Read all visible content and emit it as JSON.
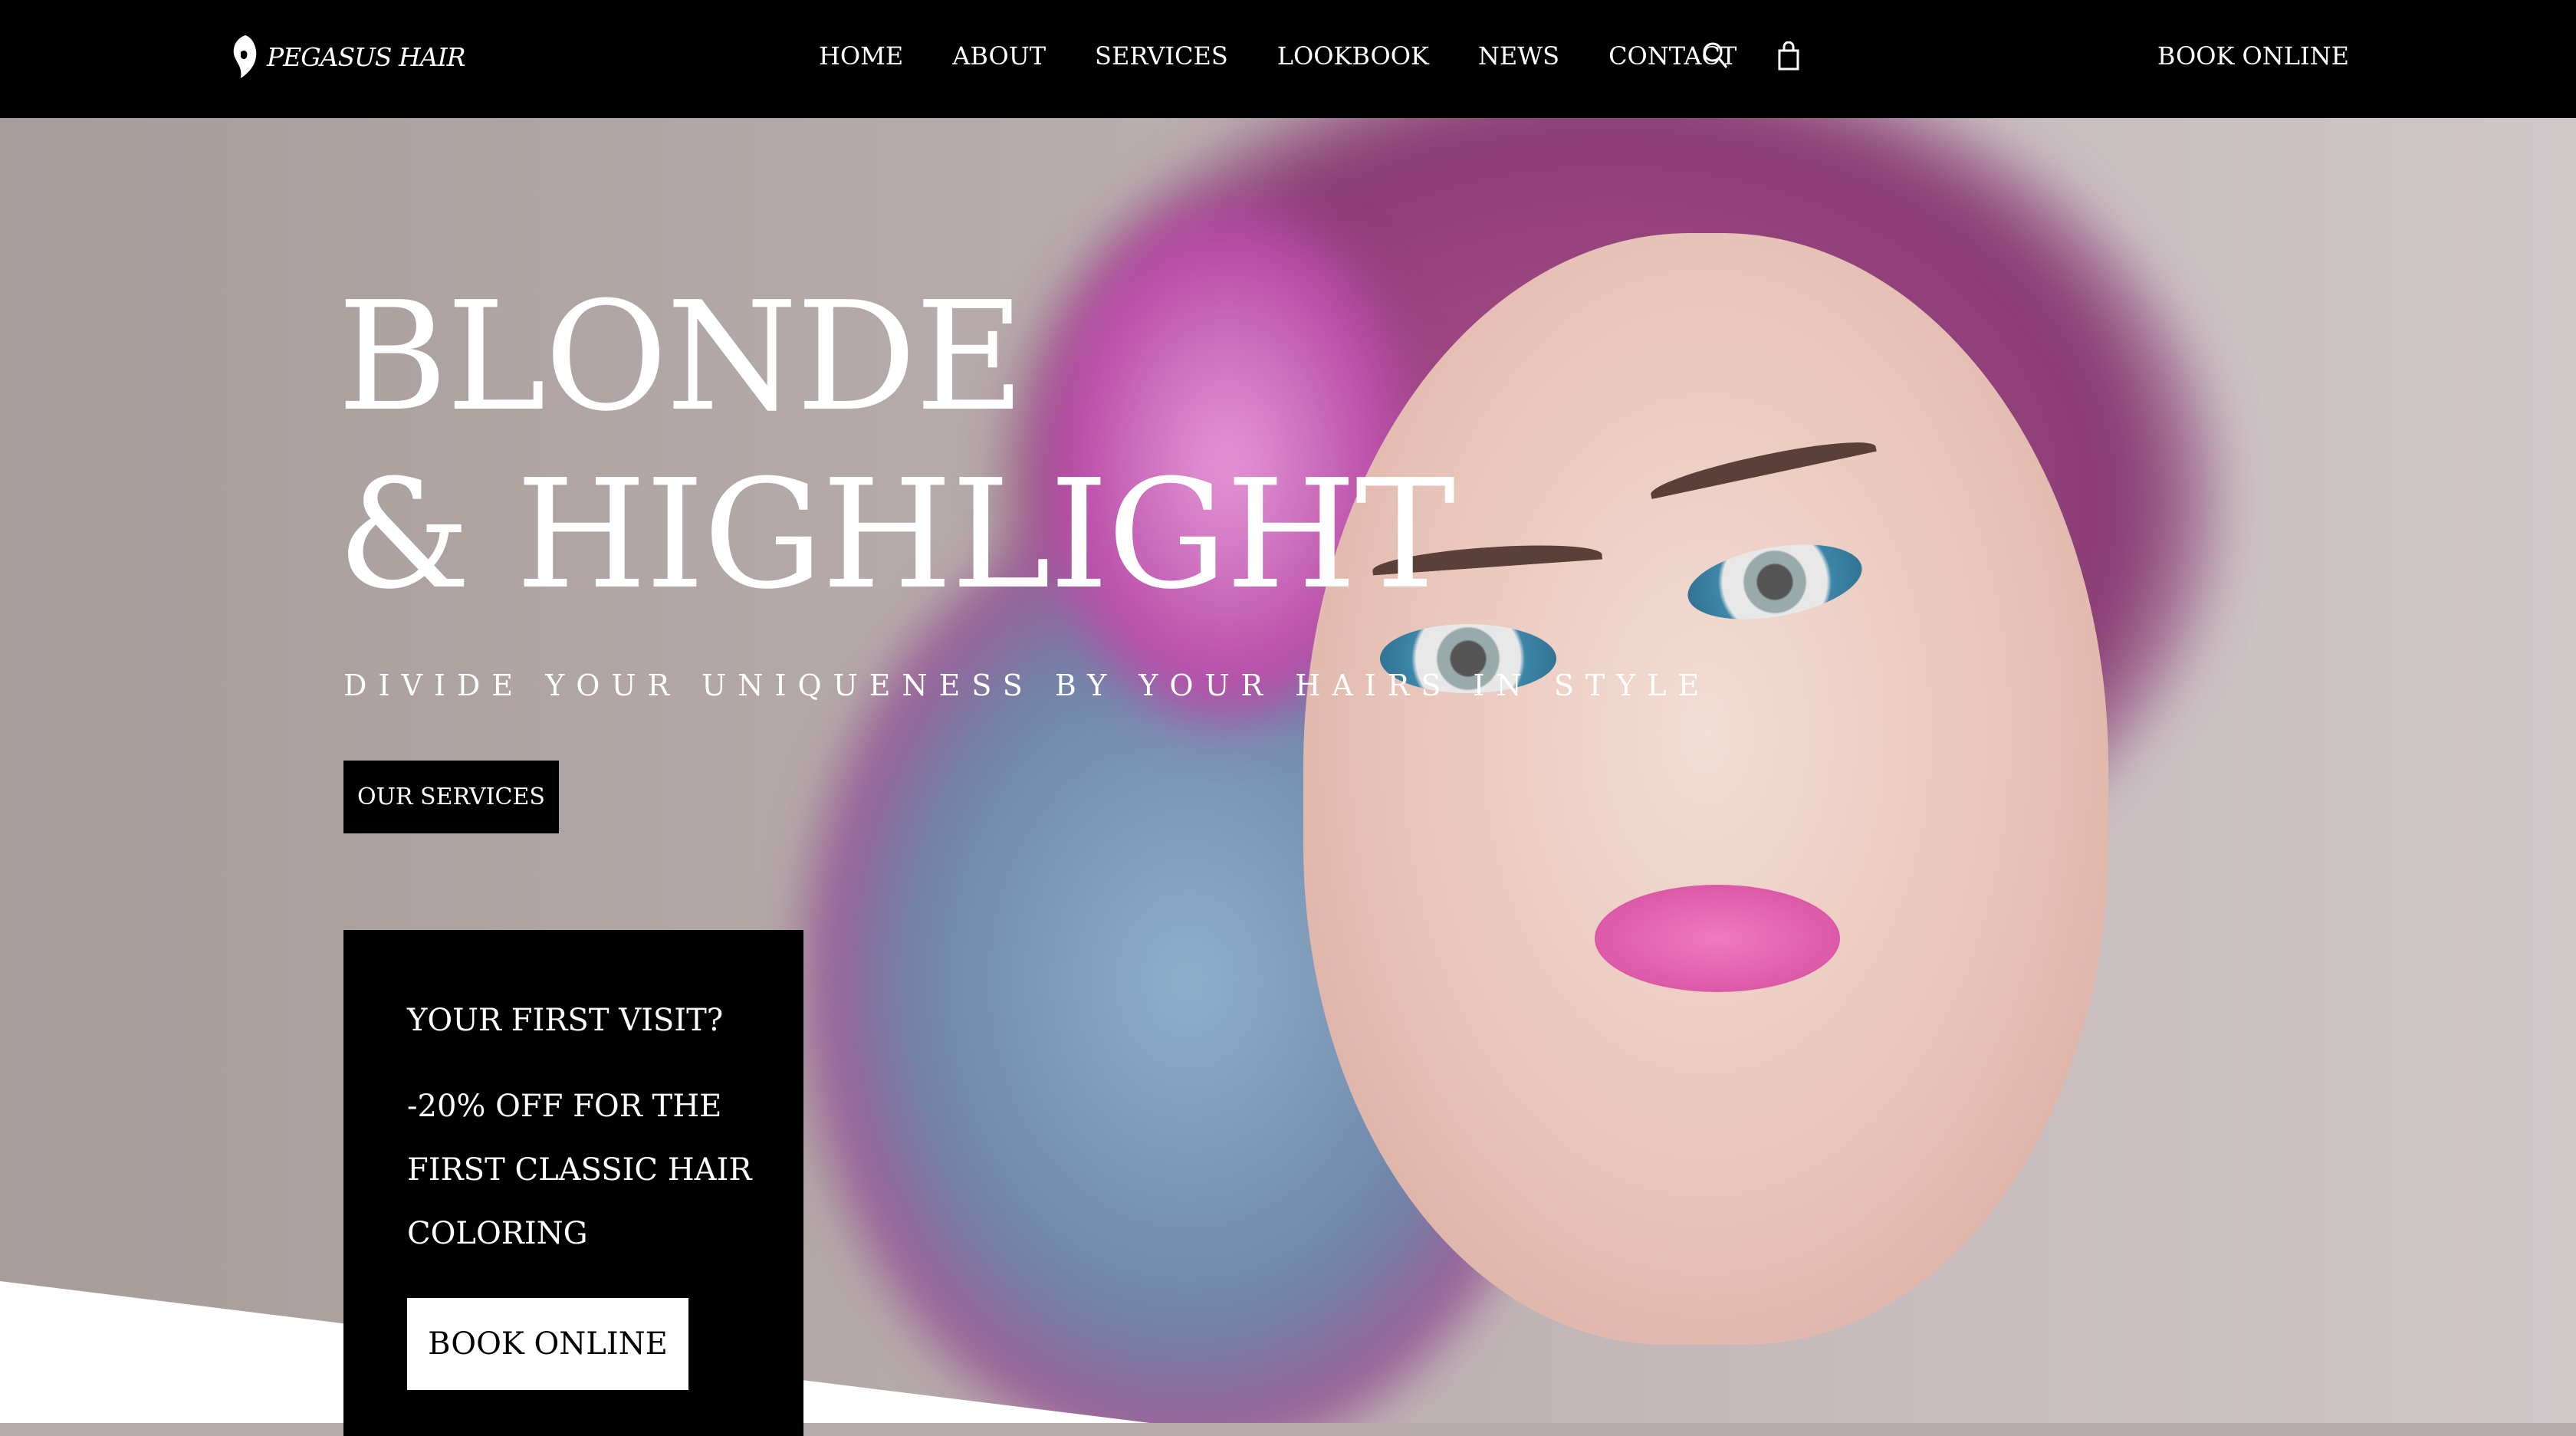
{
  "nav": {
    "logo": "PEGASUS HAIR",
    "items": [
      "HOME",
      "ABOUT",
      "SERVICES",
      "LOOKBOOK",
      "NEWS",
      "CONTACT"
    ],
    "book": "BOOK ONLINE",
    "icons": [
      "search-icon",
      "bag-icon"
    ]
  },
  "hero": {
    "title_line1": "BLONDE",
    "title_line2": "& HIGHLIGHT",
    "subtitle": "DIVIDE YOUR UNIQUENESS BY YOUR HAIRS IN STYLE",
    "services_button": "OUR SERVICES"
  },
  "promo": {
    "question": "YOUR FIRST VISIT?",
    "text_lines": [
      "-20% OFF FOR THE",
      "FIRST CLASSIC HAIR",
      "COLORING"
    ],
    "button": "BOOK ONLINE"
  }
}
